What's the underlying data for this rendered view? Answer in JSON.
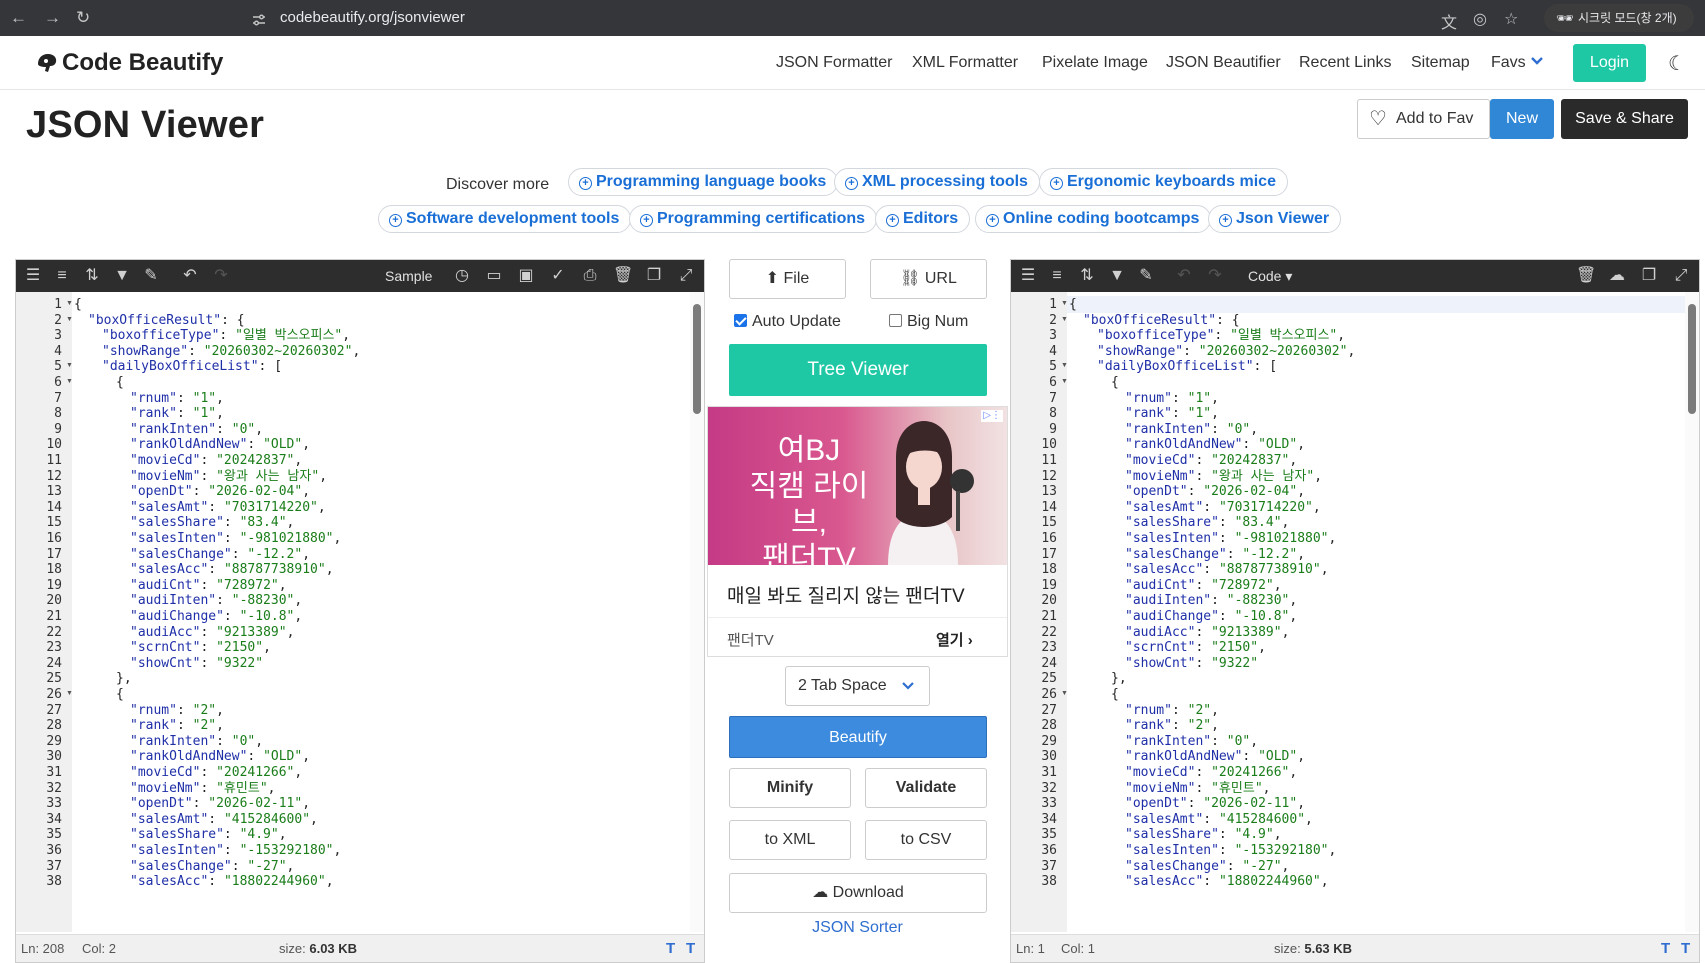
{
  "browser": {
    "url": "codebeautify.org/jsonviewer",
    "incognito_label": "시크릿 모드(창 2개)"
  },
  "site": {
    "logo_text": "Code Beautify",
    "nav": [
      "JSON Formatter",
      "XML Formatter",
      "Pixelate Image",
      "JSON Beautifier",
      "Recent Links",
      "Sitemap",
      "Favs"
    ],
    "login": "Login"
  },
  "page": {
    "title": "JSON Viewer",
    "add_to_fav": "Add to Fav",
    "new": "New",
    "save_share": "Save & Share"
  },
  "discover": {
    "label": "Discover more",
    "chips": [
      "Programming language books",
      "XML processing tools",
      "Ergonomic keyboards mice",
      "Software development tools",
      "Programming certifications",
      "Editors",
      "Online coding bootcamps",
      "Json Viewer"
    ]
  },
  "left_editor": {
    "mode_label": "Sample",
    "status": {
      "ln": "Ln: 208",
      "col": "Col: 2",
      "size_label": "size:",
      "size_value": "6.03 KB"
    }
  },
  "right_editor": {
    "mode_label": "Code ▾",
    "status": {
      "ln": "Ln: 1",
      "col": "Col: 1",
      "size_label": "size:",
      "size_value": "5.63 KB"
    }
  },
  "lines": [
    {
      "n": 1,
      "fold": true,
      "i": 0,
      "t": [
        [
          "p",
          "{"
        ]
      ]
    },
    {
      "n": 2,
      "fold": true,
      "i": 1,
      "t": [
        [
          "k",
          "\"boxOfficeResult\""
        ],
        [
          "p",
          ": {"
        ]
      ]
    },
    {
      "n": 3,
      "i": 2,
      "t": [
        [
          "k",
          "\"boxofficeType\""
        ],
        [
          "p",
          ": "
        ],
        [
          "s",
          "\"일별 박스오피스\""
        ],
        [
          "p",
          ","
        ]
      ]
    },
    {
      "n": 4,
      "i": 2,
      "t": [
        [
          "k",
          "\"showRange\""
        ],
        [
          "p",
          ": "
        ],
        [
          "s",
          "\"20260302~20260302\""
        ],
        [
          "p",
          ","
        ]
      ]
    },
    {
      "n": 5,
      "fold": true,
      "i": 2,
      "t": [
        [
          "k",
          "\"dailyBoxOfficeList\""
        ],
        [
          "p",
          ": ["
        ]
      ]
    },
    {
      "n": 6,
      "fold": true,
      "i": 3,
      "t": [
        [
          "p",
          "{"
        ]
      ]
    },
    {
      "n": 7,
      "i": 4,
      "t": [
        [
          "k",
          "\"rnum\""
        ],
        [
          "p",
          ": "
        ],
        [
          "s",
          "\"1\""
        ],
        [
          "p",
          ","
        ]
      ]
    },
    {
      "n": 8,
      "i": 4,
      "t": [
        [
          "k",
          "\"rank\""
        ],
        [
          "p",
          ": "
        ],
        [
          "s",
          "\"1\""
        ],
        [
          "p",
          ","
        ]
      ]
    },
    {
      "n": 9,
      "i": 4,
      "t": [
        [
          "k",
          "\"rankInten\""
        ],
        [
          "p",
          ": "
        ],
        [
          "s",
          "\"0\""
        ],
        [
          "p",
          ","
        ]
      ]
    },
    {
      "n": 10,
      "i": 4,
      "t": [
        [
          "k",
          "\"rankOldAndNew\""
        ],
        [
          "p",
          ": "
        ],
        [
          "s",
          "\"OLD\""
        ],
        [
          "p",
          ","
        ]
      ]
    },
    {
      "n": 11,
      "i": 4,
      "t": [
        [
          "k",
          "\"movieCd\""
        ],
        [
          "p",
          ": "
        ],
        [
          "s",
          "\"20242837\""
        ],
        [
          "p",
          ","
        ]
      ]
    },
    {
      "n": 12,
      "i": 4,
      "t": [
        [
          "k",
          "\"movieNm\""
        ],
        [
          "p",
          ": "
        ],
        [
          "s",
          "\"왕과 사는 남자\""
        ],
        [
          "p",
          ","
        ]
      ]
    },
    {
      "n": 13,
      "i": 4,
      "t": [
        [
          "k",
          "\"openDt\""
        ],
        [
          "p",
          ": "
        ],
        [
          "s",
          "\"2026-02-04\""
        ],
        [
          "p",
          ","
        ]
      ]
    },
    {
      "n": 14,
      "i": 4,
      "t": [
        [
          "k",
          "\"salesAmt\""
        ],
        [
          "p",
          ": "
        ],
        [
          "s",
          "\"7031714220\""
        ],
        [
          "p",
          ","
        ]
      ]
    },
    {
      "n": 15,
      "i": 4,
      "t": [
        [
          "k",
          "\"salesShare\""
        ],
        [
          "p",
          ": "
        ],
        [
          "s",
          "\"83.4\""
        ],
        [
          "p",
          ","
        ]
      ]
    },
    {
      "n": 16,
      "i": 4,
      "t": [
        [
          "k",
          "\"salesInten\""
        ],
        [
          "p",
          ": "
        ],
        [
          "s",
          "\"-981021880\""
        ],
        [
          "p",
          ","
        ]
      ]
    },
    {
      "n": 17,
      "i": 4,
      "t": [
        [
          "k",
          "\"salesChange\""
        ],
        [
          "p",
          ": "
        ],
        [
          "s",
          "\"-12.2\""
        ],
        [
          "p",
          ","
        ]
      ]
    },
    {
      "n": 18,
      "i": 4,
      "t": [
        [
          "k",
          "\"salesAcc\""
        ],
        [
          "p",
          ": "
        ],
        [
          "s",
          "\"88787738910\""
        ],
        [
          "p",
          ","
        ]
      ]
    },
    {
      "n": 19,
      "i": 4,
      "t": [
        [
          "k",
          "\"audiCnt\""
        ],
        [
          "p",
          ": "
        ],
        [
          "s",
          "\"728972\""
        ],
        [
          "p",
          ","
        ]
      ]
    },
    {
      "n": 20,
      "i": 4,
      "t": [
        [
          "k",
          "\"audiInten\""
        ],
        [
          "p",
          ": "
        ],
        [
          "s",
          "\"-88230\""
        ],
        [
          "p",
          ","
        ]
      ]
    },
    {
      "n": 21,
      "i": 4,
      "t": [
        [
          "k",
          "\"audiChange\""
        ],
        [
          "p",
          ": "
        ],
        [
          "s",
          "\"-10.8\""
        ],
        [
          "p",
          ","
        ]
      ]
    },
    {
      "n": 22,
      "i": 4,
      "t": [
        [
          "k",
          "\"audiAcc\""
        ],
        [
          "p",
          ": "
        ],
        [
          "s",
          "\"9213389\""
        ],
        [
          "p",
          ","
        ]
      ]
    },
    {
      "n": 23,
      "i": 4,
      "t": [
        [
          "k",
          "\"scrnCnt\""
        ],
        [
          "p",
          ": "
        ],
        [
          "s",
          "\"2150\""
        ],
        [
          "p",
          ","
        ]
      ]
    },
    {
      "n": 24,
      "i": 4,
      "t": [
        [
          "k",
          "\"showCnt\""
        ],
        [
          "p",
          ": "
        ],
        [
          "s",
          "\"9322\""
        ]
      ]
    },
    {
      "n": 25,
      "i": 3,
      "t": [
        [
          "p",
          "},"
        ]
      ]
    },
    {
      "n": 26,
      "fold": true,
      "i": 3,
      "t": [
        [
          "p",
          "{"
        ]
      ]
    },
    {
      "n": 27,
      "i": 4,
      "t": [
        [
          "k",
          "\"rnum\""
        ],
        [
          "p",
          ": "
        ],
        [
          "s",
          "\"2\""
        ],
        [
          "p",
          ","
        ]
      ]
    },
    {
      "n": 28,
      "i": 4,
      "t": [
        [
          "k",
          "\"rank\""
        ],
        [
          "p",
          ": "
        ],
        [
          "s",
          "\"2\""
        ],
        [
          "p",
          ","
        ]
      ]
    },
    {
      "n": 29,
      "i": 4,
      "t": [
        [
          "k",
          "\"rankInten\""
        ],
        [
          "p",
          ": "
        ],
        [
          "s",
          "\"0\""
        ],
        [
          "p",
          ","
        ]
      ]
    },
    {
      "n": 30,
      "i": 4,
      "t": [
        [
          "k",
          "\"rankOldAndNew\""
        ],
        [
          "p",
          ": "
        ],
        [
          "s",
          "\"OLD\""
        ],
        [
          "p",
          ","
        ]
      ]
    },
    {
      "n": 31,
      "i": 4,
      "t": [
        [
          "k",
          "\"movieCd\""
        ],
        [
          "p",
          ": "
        ],
        [
          "s",
          "\"20241266\""
        ],
        [
          "p",
          ","
        ]
      ]
    },
    {
      "n": 32,
      "i": 4,
      "t": [
        [
          "k",
          "\"movieNm\""
        ],
        [
          "p",
          ": "
        ],
        [
          "s",
          "\"휴민트\""
        ],
        [
          "p",
          ","
        ]
      ]
    },
    {
      "n": 33,
      "i": 4,
      "t": [
        [
          "k",
          "\"openDt\""
        ],
        [
          "p",
          ": "
        ],
        [
          "s",
          "\"2026-02-11\""
        ],
        [
          "p",
          ","
        ]
      ]
    },
    {
      "n": 34,
      "i": 4,
      "t": [
        [
          "k",
          "\"salesAmt\""
        ],
        [
          "p",
          ": "
        ],
        [
          "s",
          "\"415284600\""
        ],
        [
          "p",
          ","
        ]
      ]
    },
    {
      "n": 35,
      "i": 4,
      "t": [
        [
          "k",
          "\"salesShare\""
        ],
        [
          "p",
          ": "
        ],
        [
          "s",
          "\"4.9\""
        ],
        [
          "p",
          ","
        ]
      ]
    },
    {
      "n": 36,
      "i": 4,
      "t": [
        [
          "k",
          "\"salesInten\""
        ],
        [
          "p",
          ": "
        ],
        [
          "s",
          "\"-153292180\""
        ],
        [
          "p",
          ","
        ]
      ]
    },
    {
      "n": 37,
      "i": 4,
      "t": [
        [
          "k",
          "\"salesChange\""
        ],
        [
          "p",
          ": "
        ],
        [
          "s",
          "\"-27\""
        ],
        [
          "p",
          ","
        ]
      ]
    },
    {
      "n": 38,
      "i": 4,
      "t": [
        [
          "k",
          "\"salesAcc\""
        ],
        [
          "p",
          ": "
        ],
        [
          "s",
          "\"18802244960\""
        ],
        [
          "p",
          ","
        ]
      ]
    }
  ],
  "middle": {
    "file": "File",
    "url": "URL",
    "auto_update": "Auto Update",
    "auto_update_checked": true,
    "big_num": "Big Num",
    "big_num_checked": false,
    "tree_viewer": "Tree Viewer",
    "ad": {
      "image_text": "여BJ\n직캠 라이브,\n팬더TV",
      "headline": "매일 봐도 질리지 않는 팬더TV",
      "advertiser": "팬더TV",
      "open": "열기"
    },
    "tab_select": "2 Tab Space",
    "beautify": "Beautify",
    "minify": "Minify",
    "validate": "Validate",
    "to_xml": "to XML",
    "to_csv": "to CSV",
    "download": "Download",
    "json_sorter": "JSON Sorter"
  },
  "colors": {
    "accent": "#1ec8a5",
    "primary": "#2f87d6",
    "toolbar": "#2d2d2d"
  }
}
